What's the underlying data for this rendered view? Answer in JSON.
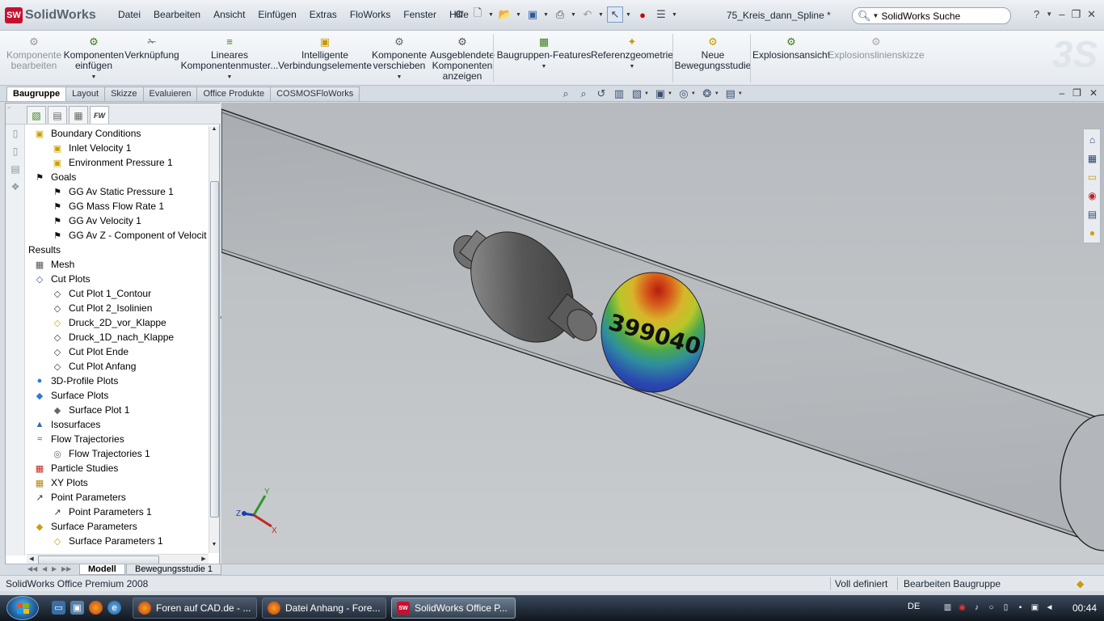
{
  "app": {
    "logo_mark": "SW",
    "logo_text": "SolidWorks",
    "document_title": "75_Kreis_dann_Spline *"
  },
  "menu": [
    "Datei",
    "Bearbeiten",
    "Ansicht",
    "Einfügen",
    "Extras",
    "FloWorks",
    "Fenster",
    "Hilfe"
  ],
  "search": {
    "value": "SolidWorks Suche",
    "icon": "search-icon"
  },
  "command_manager": [
    {
      "label": "Komponente bearbeiten",
      "lines": [
        "Komponente",
        "bearbeiten"
      ],
      "icon": "edit-component-icon",
      "disabled": true
    },
    {
      "label": "Komponenten einfügen",
      "lines": [
        "Komponenten",
        "einfügen"
      ],
      "icon": "insert-components-icon",
      "dropdown": true
    },
    {
      "label": "Verknüpfung",
      "lines": [
        "Verknüpfung"
      ],
      "icon": "mate-icon"
    },
    {
      "label": "Lineares Komponentenmuster...",
      "lines": [
        "Lineares",
        "Komponentenmuster..."
      ],
      "icon": "linear-pattern-icon",
      "dropdown": true
    },
    {
      "label": "Intelligente Verbindungselemente",
      "lines": [
        "Intelligente",
        "Verbindungselemente"
      ],
      "icon": "smart-fasteners-icon"
    },
    {
      "label": "Komponente verschieben",
      "lines": [
        "Komponente",
        "verschieben"
      ],
      "icon": "move-component-icon",
      "dropdown": true
    },
    {
      "label": "Ausgeblendete Komponenten anzeigen",
      "lines": [
        "Ausgeblendete",
        "Komponenten",
        "anzeigen"
      ],
      "icon": "show-hidden-icon"
    },
    {
      "label": "Baugruppen-Features",
      "lines": [
        "Baugruppen-Features"
      ],
      "icon": "assembly-features-icon",
      "dropdown": true
    },
    {
      "label": "Referenzgeometrie",
      "lines": [
        "Referenzgeometrie"
      ],
      "icon": "reference-geometry-icon",
      "dropdown": true
    },
    {
      "label": "Neue Bewegungsstudie",
      "lines": [
        "Neue",
        "Bewegungsstudie"
      ],
      "icon": "motion-study-icon"
    },
    {
      "label": "Explosionsansicht",
      "lines": [
        "Explosionsansicht"
      ],
      "icon": "exploded-view-icon"
    },
    {
      "label": "Explosionslinienskizze",
      "lines": [
        "Explosionslinienskizze"
      ],
      "icon": "explode-line-sketch-icon",
      "disabled": true
    }
  ],
  "tabs": [
    "Baugruppe",
    "Layout",
    "Skizze",
    "Evaluieren",
    "Office Produkte",
    "COSMOSFloWorks"
  ],
  "active_tab": "Baugruppe",
  "tree": [
    {
      "label": "Boundary Conditions",
      "level": 0,
      "icon": "boundary-conditions-icon"
    },
    {
      "label": "Inlet Velocity 1",
      "level": 1,
      "icon": "inlet-velocity-icon"
    },
    {
      "label": "Environment Pressure 1",
      "level": 1,
      "icon": "environment-pressure-icon"
    },
    {
      "label": "Goals",
      "level": 0,
      "icon": "goals-flag-icon"
    },
    {
      "label": "GG Av Static Pressure 1",
      "level": 1,
      "icon": "goal-flag-icon"
    },
    {
      "label": "GG Mass Flow Rate 1",
      "level": 1,
      "icon": "goal-flag-icon"
    },
    {
      "label": "GG Av Velocity 1",
      "level": 1,
      "icon": "goal-flag-icon"
    },
    {
      "label": "GG Av Z - Component of Velocit",
      "level": 1,
      "icon": "goal-flag-icon"
    },
    {
      "label": "Results",
      "level": -1,
      "icon": ""
    },
    {
      "label": "Mesh",
      "level": 0,
      "icon": "mesh-icon"
    },
    {
      "label": "Cut Plots",
      "level": 0,
      "icon": "cut-plots-icon"
    },
    {
      "label": "Cut Plot 1_Contour",
      "level": 1,
      "icon": "cut-plot-icon"
    },
    {
      "label": "Cut Plot 2_Isolinien",
      "level": 1,
      "icon": "cut-plot-icon"
    },
    {
      "label": "Druck_2D_vor_Klappe",
      "level": 1,
      "icon": "cut-plot-active-icon"
    },
    {
      "label": "Druck_1D_nach_Klappe",
      "level": 1,
      "icon": "cut-plot-icon"
    },
    {
      "label": "Cut Plot Ende",
      "level": 1,
      "icon": "cut-plot-icon"
    },
    {
      "label": "Cut Plot Anfang",
      "level": 1,
      "icon": "cut-plot-icon"
    },
    {
      "label": "3D-Profile Plots",
      "level": 0,
      "icon": "profile-plots-icon"
    },
    {
      "label": "Surface Plots",
      "level": 0,
      "icon": "surface-plots-icon"
    },
    {
      "label": "Surface Plot 1",
      "level": 1,
      "icon": "surface-plot-icon"
    },
    {
      "label": "Isosurfaces",
      "level": 0,
      "icon": "isosurfaces-icon"
    },
    {
      "label": "Flow Trajectories",
      "level": 0,
      "icon": "flow-trajectories-icon"
    },
    {
      "label": "Flow Trajectories 1",
      "level": 1,
      "icon": "flow-trajectory-icon"
    },
    {
      "label": "Particle Studies",
      "level": 0,
      "icon": "particle-studies-icon"
    },
    {
      "label": "XY Plots",
      "level": 0,
      "icon": "xy-plots-icon"
    },
    {
      "label": "Point Parameters",
      "level": 0,
      "icon": "point-parameters-icon"
    },
    {
      "label": "Point Parameters 1",
      "level": 1,
      "icon": "point-parameter-icon"
    },
    {
      "label": "Surface Parameters",
      "level": 0,
      "icon": "surface-parameters-icon"
    },
    {
      "label": "Surface Parameters 1",
      "level": 1,
      "icon": "surface-parameter-icon"
    }
  ],
  "viewport": {
    "contour_label": "399040",
    "axes": {
      "x": "X",
      "y": "Y",
      "z": "Z"
    }
  },
  "bottom_tabs": [
    "Modell",
    "Bewegungsstudie 1"
  ],
  "status": {
    "product": "SolidWorks Office Premium 2008",
    "definition": "Voll definiert",
    "mode": "Bearbeiten Baugruppe"
  },
  "taskbar": {
    "items": [
      {
        "label": "Foren auf CAD.de - ...",
        "icon": "firefox-icon",
        "active": false
      },
      {
        "label": "Datei Anhang - Fore...",
        "icon": "firefox-icon",
        "active": false
      },
      {
        "label": "SolidWorks Office P...",
        "icon": "solidworks-icon",
        "active": true
      }
    ],
    "language": "DE",
    "clock": "00:44"
  },
  "colors": {
    "accent": "#c8102e",
    "viewport_bg": "#bfc3c7"
  }
}
